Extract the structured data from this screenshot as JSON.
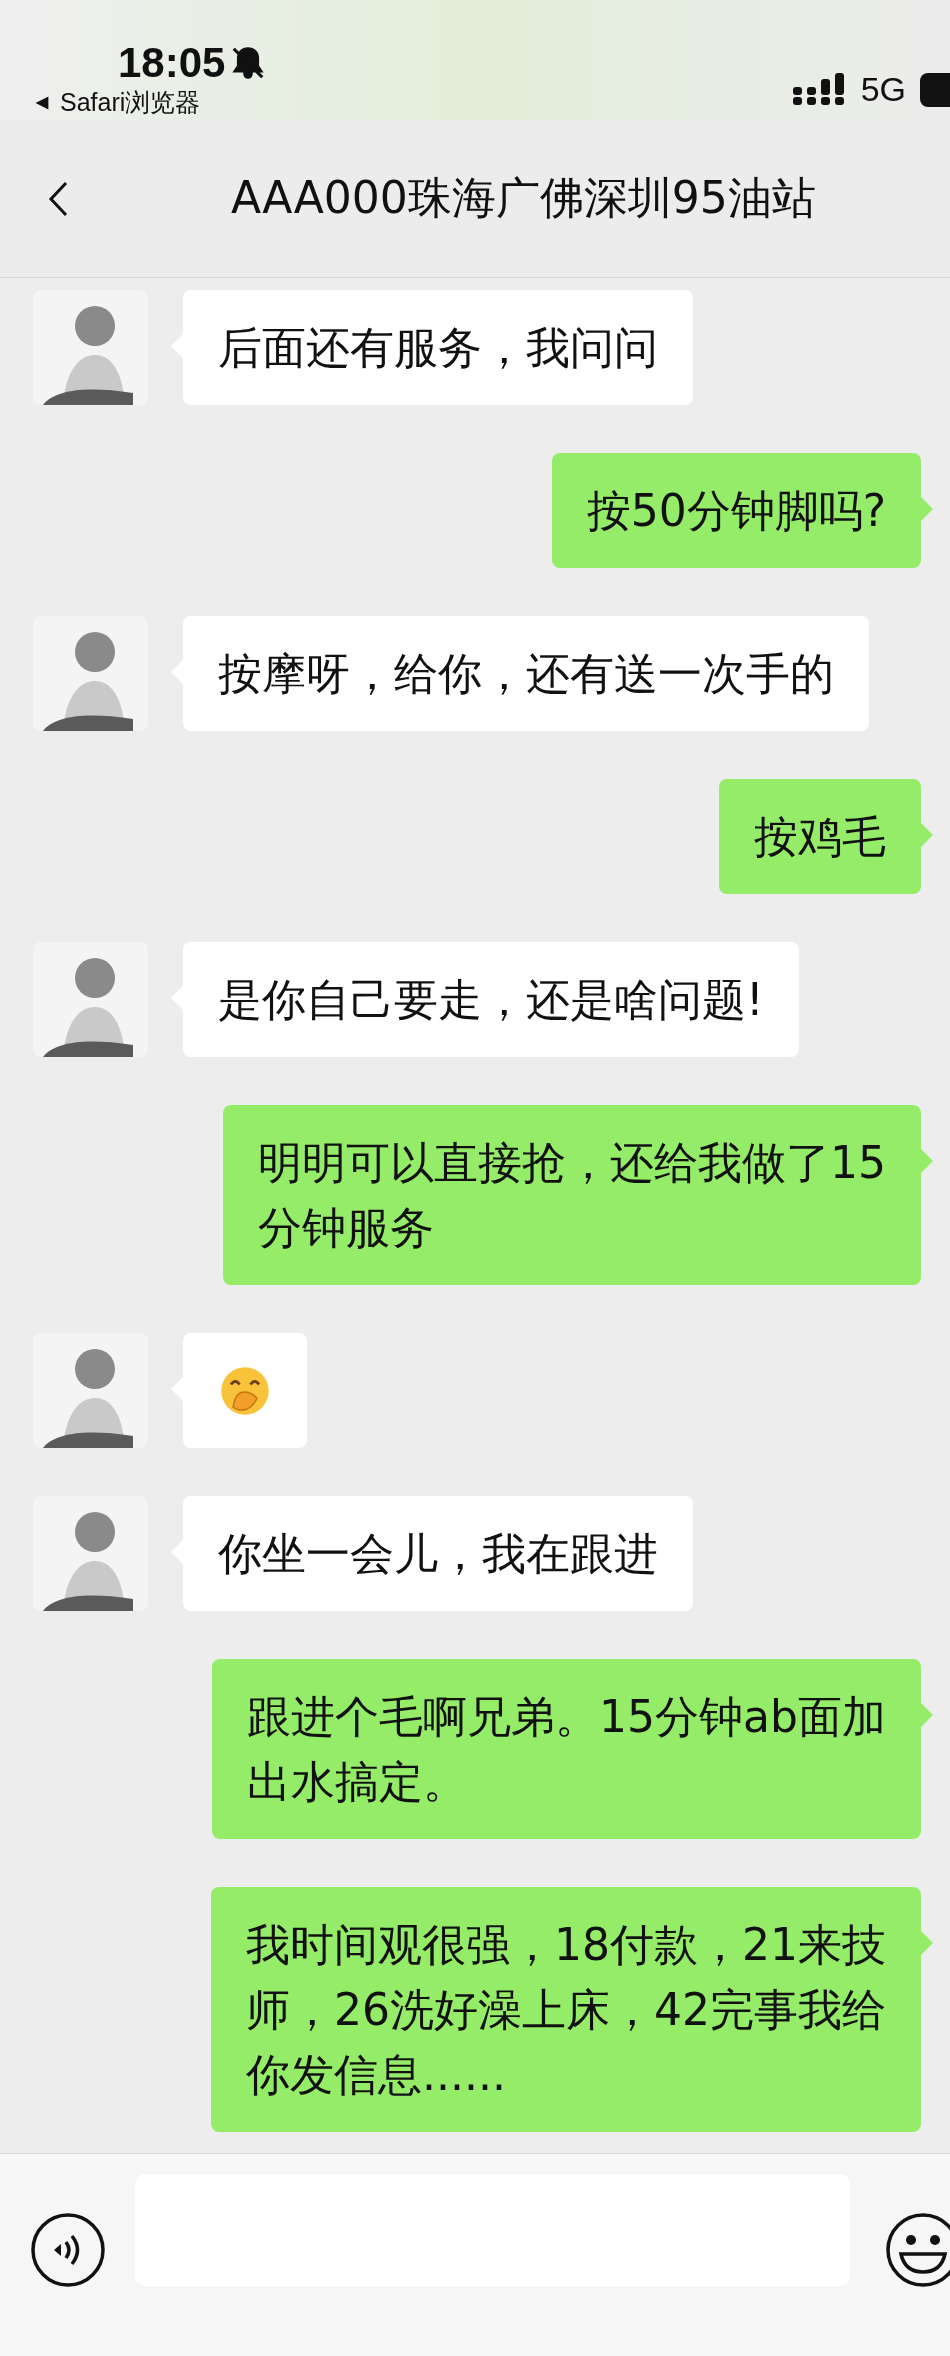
{
  "status_bar": {
    "time": "18:05",
    "back_app": "Safari浏览器",
    "network": "5G"
  },
  "nav": {
    "title": "AAA000珠海广佛深圳95油站"
  },
  "messages": [
    {
      "kind": "incoming",
      "lines": [
        "后面还有服务，我问问"
      ]
    },
    {
      "kind": "outgoing",
      "lines": [
        "按50分钟脚吗?"
      ]
    },
    {
      "kind": "incoming",
      "lines": [
        "按摩呀，给你，还有送一次手的"
      ]
    },
    {
      "kind": "outgoing",
      "lines": [
        "按鸡毛"
      ]
    },
    {
      "kind": "incoming",
      "lines": [
        "是你自己要走，还是啥问题!"
      ]
    },
    {
      "kind": "outgoing",
      "lines": [
        "明明可以直接抢，还给我做了15",
        "分钟服务"
      ]
    },
    {
      "kind": "sticker"
    },
    {
      "kind": "incoming",
      "lines": [
        "你坐一会儿，我在跟进"
      ]
    },
    {
      "kind": "outgoing",
      "lines": [
        "跟进个毛啊兄弟。15分钟ab面加",
        "出水搞定。"
      ]
    },
    {
      "kind": "outgoing",
      "lines": [
        "我时间观很强，18付款，21来技",
        "师，26洗好澡上床，42完事我给",
        "你发信息......"
      ]
    }
  ]
}
